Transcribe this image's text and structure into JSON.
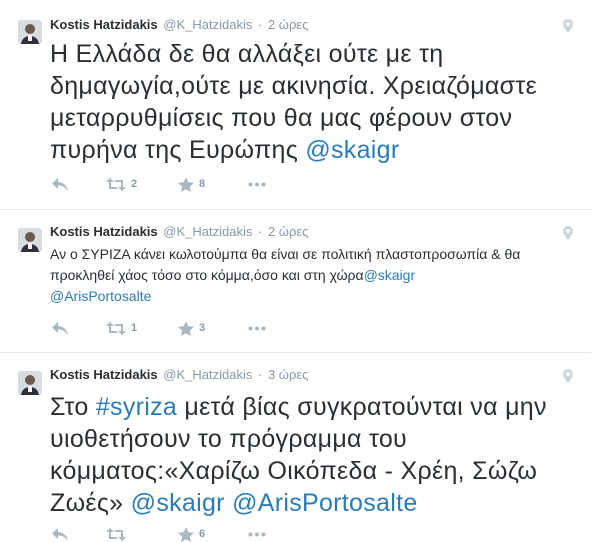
{
  "tweets": [
    {
      "author": "Kostis Hatzidakis",
      "handle": "@K_Hatzidakis",
      "separator": "·",
      "time": "2 ώρες",
      "text_parts": [
        "Η Ελλάδα δε θα αλλάξει ούτε με τη δημαγωγία,ούτε με ακινησία. Χρειαζόμαστε μεταρρυθμίσεις που θα μας φέρουν στον πυρήνα της Ευρώπης ",
        "@skaigr"
      ],
      "retweets": "2",
      "favorites": "8"
    },
    {
      "author": "Kostis Hatzidakis",
      "handle": "@K_Hatzidakis",
      "separator": "·",
      "time": "2 ώρες",
      "text_parts": [
        "Αν ο ΣΥΡΙΖΑ κάνει κωλοτούμπα θα είναι σε πολιτική πλαστοπροσωπία & θα προκληθεί χάος τόσο στο κόμμα,όσο και στη χώρα",
        "@skaigr",
        "@ArisPortosalte"
      ],
      "retweets": "1",
      "favorites": "3"
    },
    {
      "author": "Kostis Hatzidakis",
      "handle": "@K_Hatzidakis",
      "separator": "·",
      "time": "3 ώρες",
      "text_parts": [
        "Στο ",
        "#syriza",
        " μετά βίας συγκρατούνται να μην υιοθετήσουν το πρόγραμμα του κόμματος:«Χαρίζω Οικόπεδα - Χρέη, Σώζω Ζωές» ",
        "@skaigr",
        " ",
        "@ArisPortosalte"
      ],
      "favorites": "6"
    }
  ],
  "icons": {
    "reply": "reply-icon",
    "retweet": "retweet-icon",
    "favorite": "star-icon",
    "more": "more-icon",
    "location": "location-pin-icon"
  },
  "colors": {
    "link": "#2b7bb9",
    "text": "#292f33",
    "meta": "#8899a6",
    "icon": "#aab8c2",
    "border": "#e1e8ed"
  }
}
